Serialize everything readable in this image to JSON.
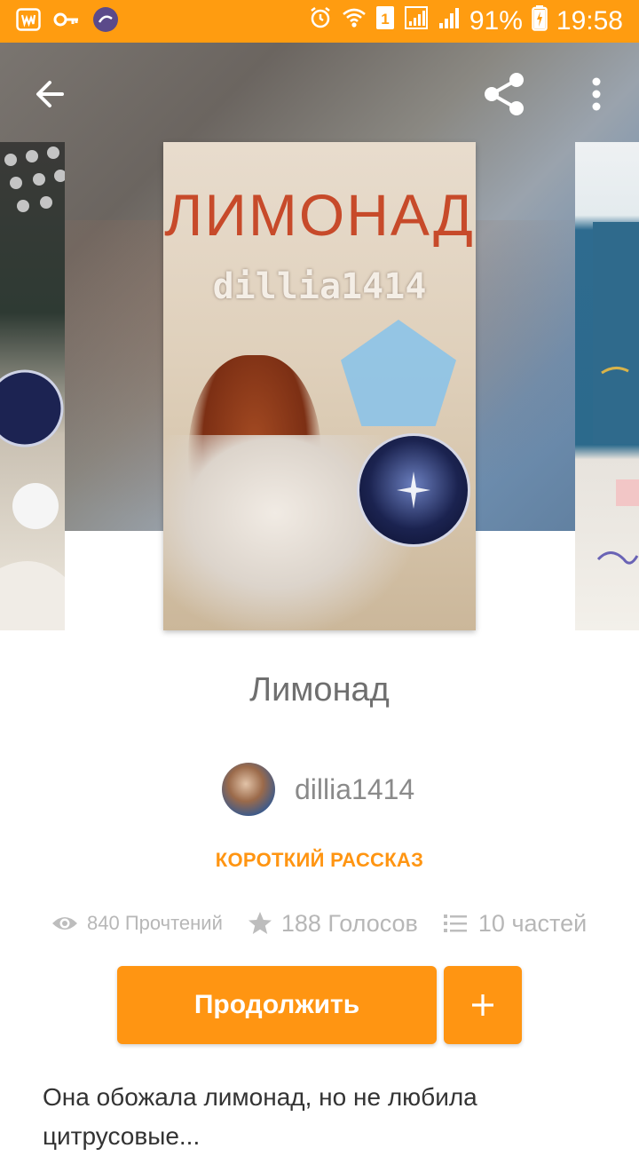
{
  "status_bar": {
    "battery": "91%",
    "time": "19:58",
    "left_icons": [
      "wattpad-notification-icon",
      "key-icon",
      "app-notification-icon"
    ],
    "right_icons": [
      "alarm-icon",
      "wifi-icon",
      "sim-1-icon",
      "signal-icon",
      "signal-icon-2",
      "battery-charging-icon"
    ]
  },
  "toolbar": {
    "back_icon": "arrow-back-icon",
    "share_icon": "share-icon",
    "menu_icon": "more-vert-icon"
  },
  "cover": {
    "title": "ЛИМОНАД",
    "author": "dillia1414"
  },
  "book": {
    "title": "Лимонад",
    "author": "dillia1414",
    "category": "КОРОТКИЙ РАССКАЗ",
    "stats": {
      "reads": "840 Прочтений",
      "votes": "188 Голосов",
      "parts": "10 частей"
    },
    "continue_label": "Продолжить",
    "add_label": "+",
    "description": "Она обожала лимонад, но не любила цитрусовые..."
  },
  "colors": {
    "accent": "#ff9512",
    "status_bar": "#ff9c10",
    "text_secondary": "#8a8a8a"
  }
}
